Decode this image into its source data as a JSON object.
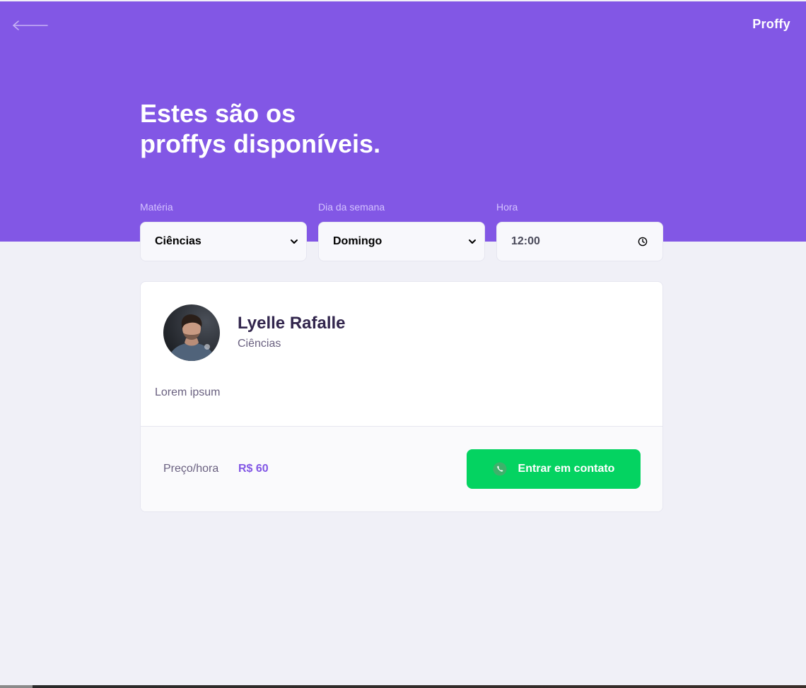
{
  "header": {
    "logo": "Proffy",
    "back_icon": "arrow-left-icon",
    "title_lines": [
      "Estes são os",
      "proffys disponíveis."
    ]
  },
  "filters": {
    "subject": {
      "label": "Matéria",
      "value": "Ciências"
    },
    "week_day": {
      "label": "Dia da semana",
      "value": "Domingo"
    },
    "time": {
      "label": "Hora",
      "value": "12:00"
    }
  },
  "teacher": {
    "name": "Lyelle Rafalle",
    "subject": "Ciências",
    "bio": "Lorem ipsum",
    "price_label": "Preço/hora",
    "price_value": "R$ 60",
    "contact_label": "Entrar em contato",
    "contact_icon": "whatsapp-icon"
  },
  "colors": {
    "primary": "#8257E5",
    "background": "#F0F0F7",
    "secondary": "#04D361",
    "title_text": "#32264D",
    "body_text": "#6A6180"
  }
}
